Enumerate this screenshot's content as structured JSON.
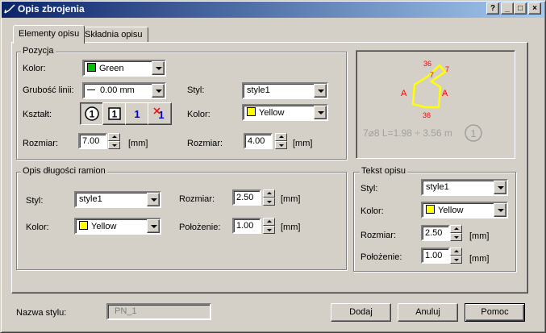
{
  "window": {
    "title": "Opis zbrojenia",
    "help_label": "?",
    "minimize_label": "_",
    "maximize_label": "□",
    "close_label": "×"
  },
  "tabs": [
    {
      "label": "Elementy opisu",
      "active": true
    },
    {
      "label": "Składnia opisu",
      "active": false
    }
  ],
  "pozycja": {
    "legend": "Pozycja",
    "kolor_label": "Kolor:",
    "kolor_value": "Green",
    "kolor_color": "#00c000",
    "grubosc_label": "Grubość linii:",
    "grubosc_value": "0.00 mm",
    "ksztalt_label": "Kształt:",
    "shape_glyphs": [
      "1",
      "1",
      "1",
      "1"
    ],
    "rozmiar_label": "Rozmiar:",
    "rozmiar_value": "7.00",
    "rozmiar_unit": "[mm]",
    "styl_label": "Styl:",
    "styl_value": "style1",
    "kolor2_label": "Kolor:",
    "kolor2_value": "Yellow",
    "kolor2_color": "#ffff00",
    "rozmiar2_label": "Rozmiar:",
    "rozmiar2_value": "4.00",
    "rozmiar2_unit": "[mm]"
  },
  "preview": {
    "label_top": "36",
    "label_seven_outer": "7",
    "label_seven_inner": "7",
    "label_left": "A",
    "label_right": "A",
    "label_bottom": "36",
    "description": "7⌀8  L=1.98 ÷ 3.56 m",
    "circle_num": "1",
    "shape_color": "#ffff00",
    "label_color": "#ff0000"
  },
  "opis_dlugosci": {
    "legend": "Opis długości ramion",
    "styl_label": "Styl:",
    "styl_value": "style1",
    "kolor_label": "Kolor:",
    "kolor_value": "Yellow",
    "kolor_color": "#ffff00",
    "rozmiar_label": "Rozmiar:",
    "rozmiar_value": "2.50",
    "rozmiar_unit": "[mm]",
    "polozenie_label": "Położenie:",
    "polozenie_value": "1.00",
    "polozenie_unit": "[mm]"
  },
  "tekst_opisu": {
    "legend": "Tekst opisu",
    "styl_label": "Styl:",
    "styl_value": "style1",
    "kolor_label": "Kolor:",
    "kolor_value": "Yellow",
    "kolor_color": "#ffff00",
    "rozmiar_label": "Rozmiar:",
    "rozmiar_value": "2.50",
    "rozmiar_unit": "[mm]",
    "polozenie_label": "Położenie:",
    "polozenie_value": "1.00",
    "polozenie_unit": "[mm]"
  },
  "footer": {
    "nazwa_label": "Nazwa stylu:",
    "nazwa_value": "PN_1",
    "dodaj_label": "Dodaj",
    "anuluj_label": "Anuluj",
    "pomoc_label": "Pomoc"
  }
}
